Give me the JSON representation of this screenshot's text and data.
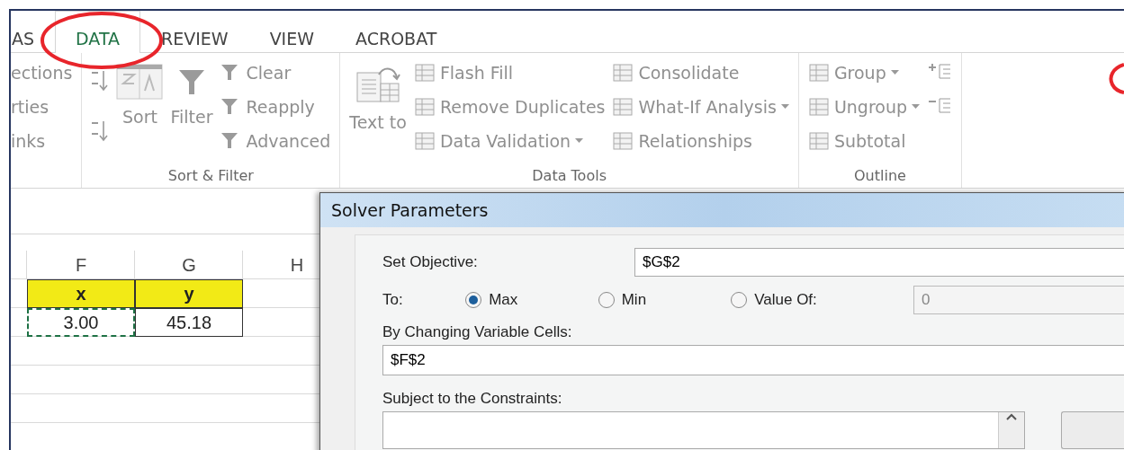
{
  "tabs": [
    {
      "label": "AS",
      "selected": false
    },
    {
      "label": "DATA",
      "selected": true
    },
    {
      "label": "REVIEW",
      "selected": false
    },
    {
      "label": "VIEW",
      "selected": false
    },
    {
      "label": "ACROBAT",
      "selected": false
    }
  ],
  "ribbon": {
    "groups": [
      {
        "items": [
          {
            "kind": "text",
            "label": "ections"
          },
          {
            "kind": "text",
            "label": "rties"
          },
          {
            "kind": "text",
            "label": "inks"
          }
        ]
      },
      {
        "label": "Sort & Filter",
        "items": [
          {
            "kind": "sort-small"
          },
          {
            "kind": "sort-small"
          },
          {
            "kind": "large",
            "label": "Sort"
          },
          {
            "kind": "large",
            "label": "Filter"
          },
          {
            "kind": "small",
            "label": "Clear",
            "dropdown": false
          },
          {
            "kind": "small",
            "label": "Reapply",
            "dropdown": false
          },
          {
            "kind": "small",
            "label": "Advanced",
            "dropdown": false
          }
        ]
      },
      {
        "label": "Data Tools",
        "items": [
          {
            "kind": "large",
            "label": "Text to"
          },
          {
            "kind": "small",
            "label": "Flash Fill",
            "dropdown": false
          },
          {
            "kind": "small",
            "label": "Remove Duplicates",
            "dropdown": false
          },
          {
            "kind": "small",
            "label": "Data Validation",
            "dropdown": true
          },
          {
            "kind": "small",
            "label": "Consolidate",
            "dropdown": false
          },
          {
            "kind": "small",
            "label": "What-If Analysis",
            "dropdown": true
          },
          {
            "kind": "small",
            "label": "Relationships",
            "dropdown": false
          }
        ]
      },
      {
        "label": "Outline",
        "items": [
          {
            "kind": "small",
            "label": "Group",
            "dropdown": true
          },
          {
            "kind": "small",
            "label": "Ungroup",
            "dropdown": true
          },
          {
            "kind": "small",
            "label": "Subtotal",
            "dropdown": false
          },
          {
            "kind": "detail-icon"
          },
          {
            "kind": "detail-icon"
          }
        ]
      }
    ]
  },
  "sheet": {
    "columns": [
      "F",
      "G",
      "H"
    ],
    "rows": [
      {
        "cells": [
          {
            "text": "x",
            "kind": "header"
          },
          {
            "text": "y",
            "kind": "header"
          }
        ]
      },
      {
        "cells": [
          {
            "text": "3.00",
            "kind": "copied"
          },
          {
            "text": "45.18",
            "kind": "boxed"
          }
        ]
      }
    ]
  },
  "dialog": {
    "title": "Solver Parameters",
    "objective": {
      "label": "Set Objective:",
      "value": "$G$2"
    },
    "to": {
      "label": "To:",
      "options": [
        {
          "label": "Max",
          "selected": true
        },
        {
          "label": "Min",
          "selected": false
        },
        {
          "label": "Value Of:",
          "selected": false
        }
      ],
      "value_field": {
        "value": "0",
        "disabled": true
      }
    },
    "changing": {
      "label": "By Changing Variable Cells:",
      "value": "$F$2"
    },
    "constraints": {
      "label": "Subject to the Constraints:"
    }
  }
}
